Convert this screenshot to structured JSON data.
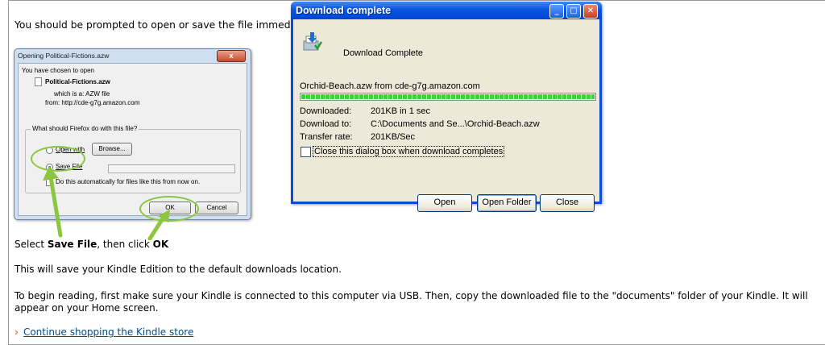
{
  "page": {
    "intro": "You should be prompted to open or save the file immedi",
    "select_prefix": "Select ",
    "select_save": "Save File",
    "select_mid": ", then click ",
    "select_ok": "OK",
    "save_info": "This will save your Kindle Edition to the default downloads location.",
    "begin_reading": "To begin reading, first make sure your Kindle is connected to this computer via USB. Then, copy the downloaded file to the \"documents\" folder of your Kindle. It will appear on your Home screen.",
    "continue_arrow": "›",
    "continue_link": "Continue shopping the Kindle store",
    "link_color": "#004b91",
    "highlight_color": "#8cc63f"
  },
  "firefox_dialog": {
    "title": "Opening Political-Fictions.azw",
    "close_glyph": "x",
    "chosen_label": "You have chosen to open",
    "filename": "Political-Fictions.azw",
    "which_is": "which is a:  AZW file",
    "from": "from: http://cde-g7g.amazon.com",
    "group_label": "What should Firefox do with this file?",
    "open_with_label": "Open with",
    "browse_label": "Browse...",
    "save_file_label": "Save File",
    "save_file_selected": true,
    "auto_label": "Do this automatically for files like this from now on.",
    "ok_label": "OK",
    "cancel_label": "Cancel"
  },
  "download_window": {
    "title": "Download complete",
    "min_glyph": "_",
    "max_glyph": "□",
    "close_glyph": "✕",
    "heading": "Download Complete",
    "file_from": "Orchid-Beach.azw from cde-g7g.amazon.com",
    "progress_percent": 100,
    "downloaded_label": "Downloaded:",
    "downloaded_value": "201KB in 1 sec",
    "download_to_label": "Download to:",
    "download_to_value": "C:\\Documents and Se...\\Orchid-Beach.azw",
    "rate_label": "Transfer rate:",
    "rate_value": "201KB/Sec",
    "close_when_done": "Close this dialog box when download completes",
    "close_when_done_checked": false,
    "open_label": "Open",
    "open_folder_label": "Open Folder",
    "close_label": "Close"
  }
}
